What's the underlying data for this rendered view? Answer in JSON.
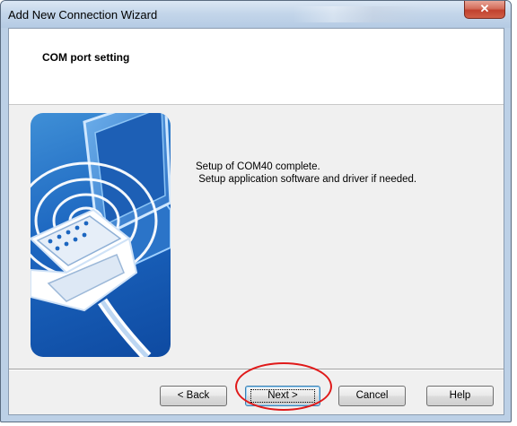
{
  "window": {
    "title": "Add New Connection Wizard",
    "close_glyph": "✕",
    "close_icon": "close-icon"
  },
  "header": {
    "title": "COM port setting"
  },
  "illustration": {
    "icon": "serial-port-connection-illustration",
    "colors": {
      "background": "#1c66c0",
      "rings": "#ffffff"
    }
  },
  "content": {
    "message": "Setup of COM40 complete.\n Setup application software and driver if needed."
  },
  "buttons": {
    "back_label": "< Back",
    "next_label": "Next >",
    "cancel_label": "Cancel",
    "help_label": "Help"
  },
  "annotation": {
    "highlighted": "next-button",
    "color": "#e01a1a"
  }
}
